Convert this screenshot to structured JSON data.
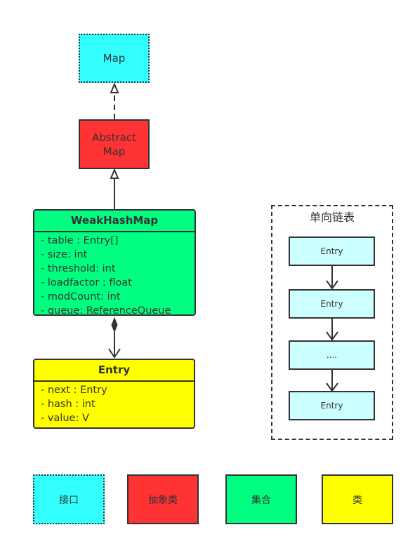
{
  "diagram": {
    "interface_node": {
      "label": "Map"
    },
    "abstract_node": {
      "label_lines": [
        "Abstract",
        "Map"
      ]
    },
    "main_class": {
      "name": "WeakHashMap",
      "attributes": [
        "- table : Entry[]",
        "- size: int",
        "- threshold: int",
        "- loadfactor : float",
        "- modCount: int",
        "- queue: ReferenceQueue"
      ]
    },
    "entry_class": {
      "name": "Entry",
      "attributes": [
        "- next : Entry",
        "- hash :  int",
        "- value: V"
      ]
    },
    "linked_list": {
      "title": "单向链表",
      "nodes": [
        "Entry",
        "Entry",
        "....",
        "Entry"
      ]
    },
    "relations": [
      {
        "from": "AbstractMap",
        "to": "Map",
        "type": "realization (dashed, hollow arrow)"
      },
      {
        "from": "WeakHashMap",
        "to": "AbstractMap",
        "type": "generalization (hollow arrow)"
      },
      {
        "from": "WeakHashMap",
        "to": "Entry",
        "type": "composition (filled diamond, open arrow)"
      }
    ],
    "legend": [
      {
        "label": "接口",
        "color": "#33ffff",
        "border": "dotted"
      },
      {
        "label": "抽象类",
        "color": "#ff3333",
        "border": "solid"
      },
      {
        "label": "集合",
        "color": "#00ff80",
        "border": "solid"
      },
      {
        "label": "类",
        "color": "#ffff00",
        "border": "solid"
      }
    ]
  }
}
